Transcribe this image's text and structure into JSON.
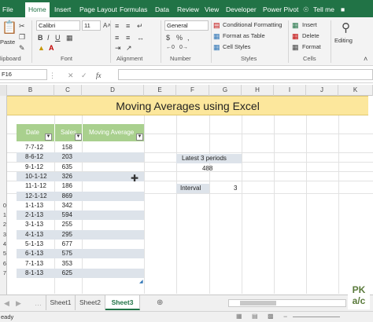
{
  "ribbon_tabs": [
    "File",
    "Home",
    "Insert",
    "Page Layout",
    "Formulas",
    "Data",
    "Review",
    "View",
    "Developer",
    "Power Pivot"
  ],
  "tell_me": "Tell me",
  "clipboard": {
    "paste": "Paste",
    "label": "lipboard"
  },
  "font": {
    "name": "Calibri",
    "size": "11",
    "label": "Font"
  },
  "alignment": {
    "label": "Alignment"
  },
  "number": {
    "format": "General",
    "label": "Number"
  },
  "styles": {
    "conditional": "Conditional Formatting",
    "format_table": "Format as Table",
    "cell_styles": "Cell Styles",
    "label": "Styles"
  },
  "cells": {
    "insert": "Insert",
    "delete": "Delete",
    "format": "Format",
    "label": "Cells"
  },
  "editing": {
    "label": "Editing"
  },
  "formula_bar": {
    "name_box": "F16",
    "fx": "fx",
    "value": ""
  },
  "columns": [
    "B",
    "C",
    "D",
    "E",
    "F",
    "G",
    "H",
    "I",
    "J",
    "K"
  ],
  "row_headers": [
    "0",
    "1",
    "2",
    "3",
    "4",
    "5",
    "6",
    "7"
  ],
  "title": "Moving Averages using Excel",
  "table": {
    "headers": [
      "Date",
      "Sales",
      "Moving Average"
    ],
    "rows": [
      {
        "date": "7-7-12",
        "sales": "158"
      },
      {
        "date": "8-6-12",
        "sales": "203"
      },
      {
        "date": "9-1-12",
        "sales": "635"
      },
      {
        "date": "10-1-12",
        "sales": "326"
      },
      {
        "date": "11-1-12",
        "sales": "186"
      },
      {
        "date": "12-1-12",
        "sales": "869"
      },
      {
        "date": "1-1-13",
        "sales": "342"
      },
      {
        "date": "2-1-13",
        "sales": "594"
      },
      {
        "date": "3-1-13",
        "sales": "255"
      },
      {
        "date": "4-1-13",
        "sales": "295"
      },
      {
        "date": "5-1-13",
        "sales": "677"
      },
      {
        "date": "6-1-13",
        "sales": "575"
      },
      {
        "date": "7-1-13",
        "sales": "353"
      },
      {
        "date": "8-1-13",
        "sales": "625"
      }
    ]
  },
  "latest_label": "Latest 3 periods",
  "latest_value": "488",
  "interval_label": "Interval",
  "interval_value": "3",
  "sheets": [
    "Sheet1",
    "Sheet2",
    "Sheet3"
  ],
  "active_sheet": "Sheet3",
  "status": "eady",
  "logo": {
    "line1": "PK",
    "line2": "a/c"
  },
  "colors": {
    "excel_green": "#217346",
    "title_fill": "#fce79c",
    "header_fill": "#a9d08e",
    "band_fill": "#dde3ea"
  }
}
